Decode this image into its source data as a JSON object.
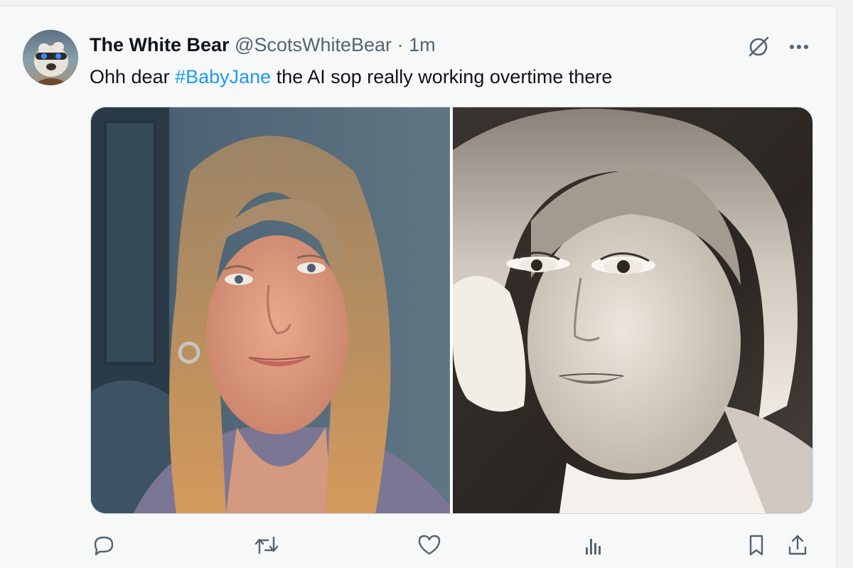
{
  "tweet": {
    "author_name": "The White Bear",
    "author_handle": "@ScotsWhiteBear",
    "separator": "·",
    "time": "1m",
    "text_before": "Ohh dear ",
    "hashtag": "#BabyJane",
    "text_after": " the AI sop really working overtime there"
  },
  "icons": {
    "grok": "grok-icon",
    "more": "more-icon",
    "reply": "reply-icon",
    "retweet": "retweet-icon",
    "like": "heart-icon",
    "views": "analytics-icon",
    "bookmark": "bookmark-icon",
    "share": "share-icon"
  },
  "colors": {
    "text": "#0f1419",
    "secondary": "#536471",
    "link": "#1d9bf0",
    "background": "#f7f9f9"
  }
}
